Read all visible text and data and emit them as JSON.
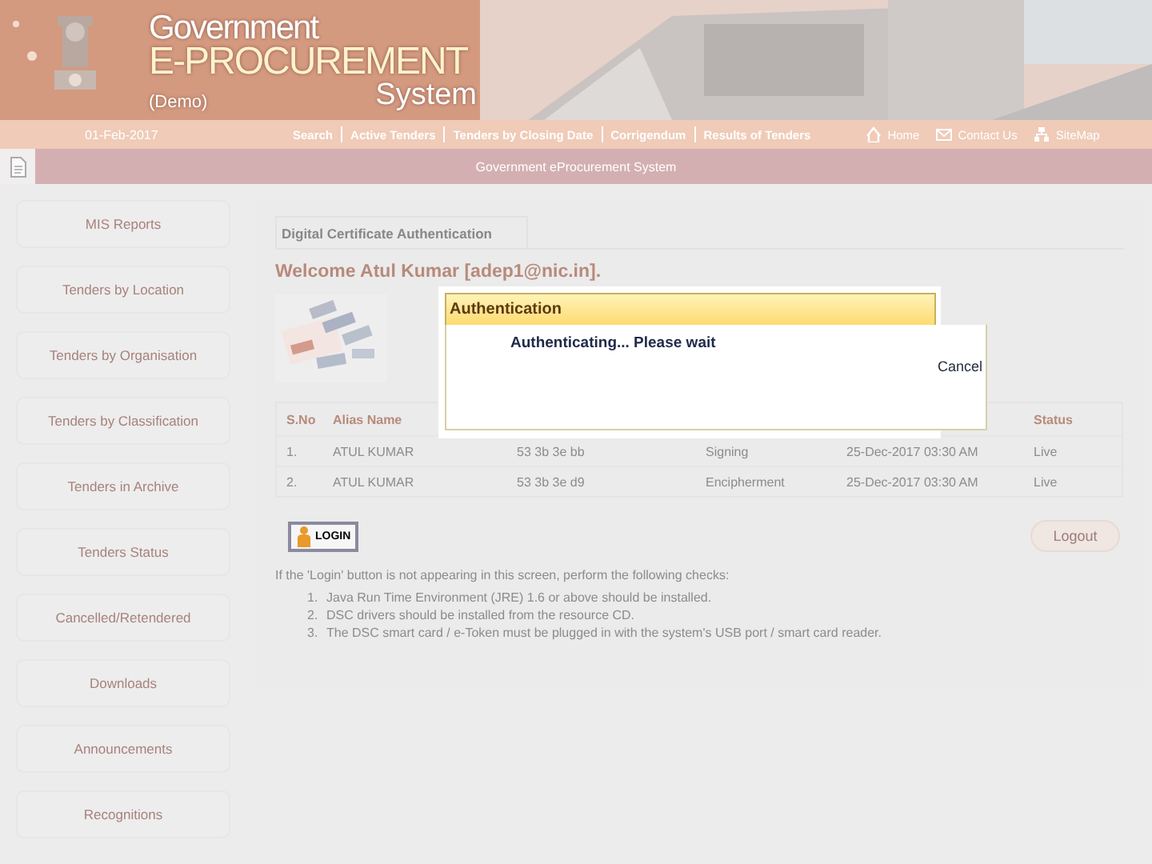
{
  "header": {
    "title_top": "Government",
    "title_main": "E-PROCUREMENT",
    "title_bottom": "System",
    "edition": "(Demo)"
  },
  "nav": {
    "date": "01-Feb-2017",
    "links": [
      "Search",
      "Active Tenders",
      "Tenders by Closing Date",
      "Corrigendum",
      "Results of Tenders"
    ],
    "right_links": [
      "Home",
      "Contact Us",
      "SiteMap"
    ]
  },
  "banner": {
    "title": "Government eProcurement System"
  },
  "sidebar": {
    "items": [
      "MIS Reports",
      "Tenders by Location",
      "Tenders by Organisation",
      "Tenders by Classification",
      "Tenders in Archive",
      "Tenders Status",
      "Cancelled/Retendered",
      "Downloads",
      "Announcements",
      "Recognitions"
    ]
  },
  "content": {
    "tab": "Digital Certificate Authentication",
    "welcome": "Welcome Atul Kumar [adep1@nic.in].",
    "table": {
      "column_headers": {
        "column_1": "S.No",
        "column_2": "Alias Name",
        "column_6": "Status"
      },
      "rows": [
        [
          "1.",
          "ATUL KUMAR",
          "53 3b 3e bb",
          "Signing",
          "25-Dec-2017 03:30 AM",
          "Live"
        ],
        [
          "2.",
          "ATUL KUMAR",
          "53 3b 3e d9",
          "Encipherment",
          "25-Dec-2017 03:30 AM",
          "Live"
        ]
      ]
    },
    "login_button": "LOGIN",
    "logout_button": "Logout",
    "help_text": "If the 'Login' button is not appearing in this screen, perform the following checks:",
    "checks": [
      {
        "number": "1.",
        "text": "Java Run Time Environment (JRE) 1.6 or above should be installed."
      },
      {
        "number": "2.",
        "text": "DSC drivers should be installed from the resource CD."
      },
      {
        "number": "3.",
        "text": "The DSC smart card / e-Token must be plugged in with the system's USB port / smart card reader."
      }
    ]
  },
  "dialog": {
    "title": "Authentication",
    "message": "Authenticating... Please wait",
    "cancel": "Cancel"
  }
}
